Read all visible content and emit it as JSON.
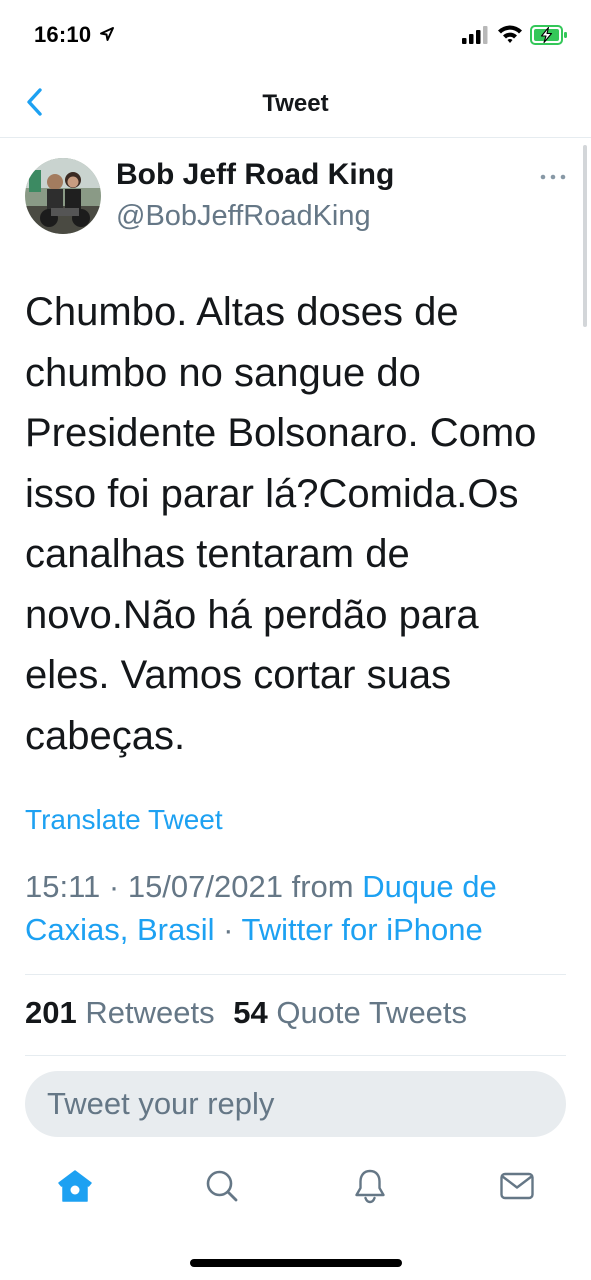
{
  "status_bar": {
    "time": "16:10",
    "icons": [
      "location-arrow-icon",
      "cellular-signal-icon",
      "wifi-icon",
      "battery-charging-icon"
    ],
    "battery_color": "#34c759"
  },
  "header": {
    "title": "Tweet",
    "back_icon": "chevron-left-icon"
  },
  "tweet": {
    "author": {
      "display_name": "Bob Jeff Road King",
      "username": "@BobJeffRoadKing"
    },
    "text": "Chumbo. Altas doses de chumbo no sangue do Presidente Bolsonaro. Como isso foi parar lá?Comida.Os canalhas tentaram de novo.Não há perdão para eles. Vamos cortar suas cabeças.",
    "translate_label": "Translate Tweet",
    "timestamp": "15:11 · 15/07/2021",
    "from_label": "from",
    "location": "Duque de Caxias, Brasil",
    "separator": "·",
    "client": "Twitter for iPhone",
    "stats": {
      "retweets_count": "201",
      "retweets_label": "Retweets",
      "quotes_count": "54",
      "quotes_label": "Quote Tweets"
    }
  },
  "reply": {
    "placeholder": "Tweet your reply"
  },
  "tab_bar": {
    "items": [
      "home-icon",
      "search-icon",
      "notifications-icon",
      "messages-icon"
    ]
  },
  "colors": {
    "accent": "#1da1f2",
    "secondary_text": "#657786",
    "primary_text": "#14171a",
    "divider": "#e6ecf0",
    "reply_background": "#e8ecef"
  }
}
